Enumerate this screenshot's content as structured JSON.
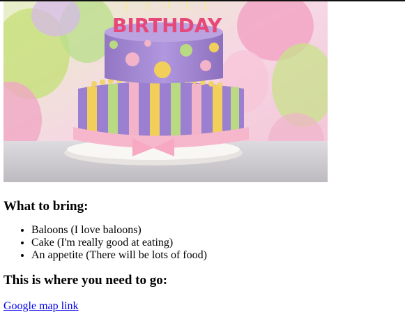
{
  "hero_image": {
    "topper_text": "BIRTHDAY",
    "colors": {
      "background_pink": "#f4c6d8",
      "cake_top": "#a98bd6",
      "cake_bottom_purple": "#9b7fd0",
      "stripe_yellow": "#f2cf5a",
      "stripe_green": "#b9d982",
      "stripe_pink": "#f3b3c8",
      "plate": "#f5f5f2"
    }
  },
  "bring_section": {
    "heading": "What to bring:",
    "items": [
      "Baloons (I love baloons)",
      "Cake (I'm really good at eating)",
      "An appetite (There will be lots of food)"
    ]
  },
  "go_section": {
    "heading": "This is where you need to go:",
    "link_text": "Google map link"
  }
}
